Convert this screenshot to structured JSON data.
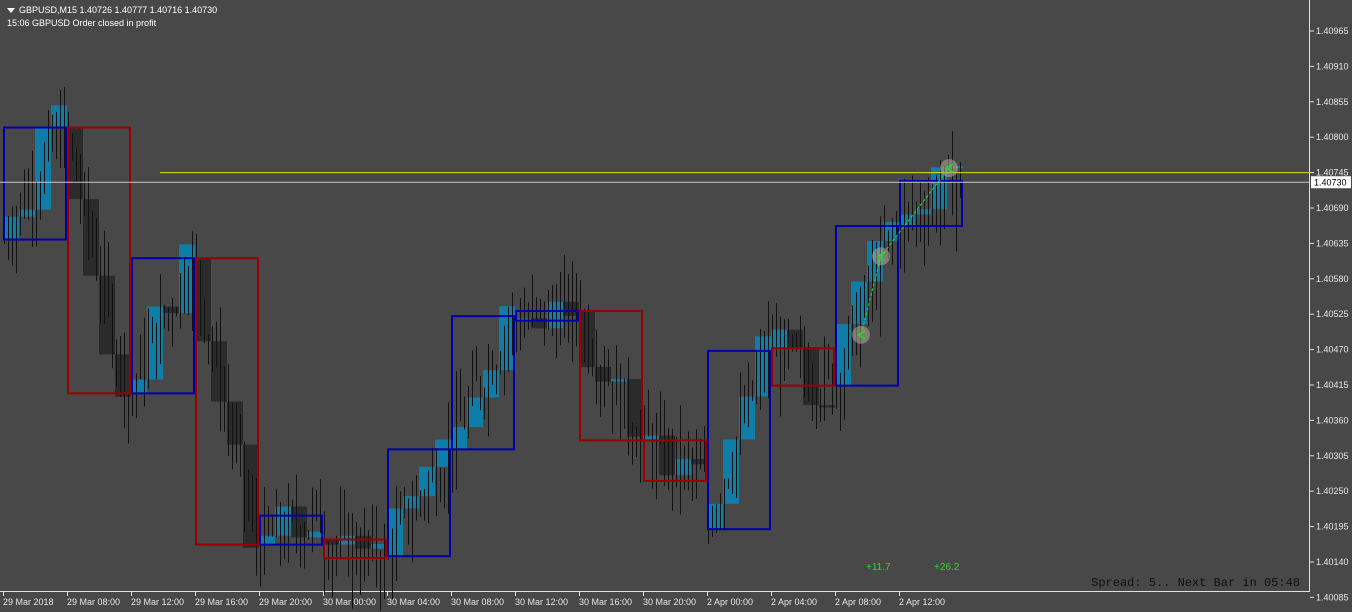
{
  "header": {
    "symbol_line": "GBPUSD,M15  1.40726 1.40777 1.40716 1.40730",
    "status_line": "15:06 GBPUSD Order closed in profit"
  },
  "price_axis": {
    "ticks": [
      "1.40965",
      "1.40910",
      "1.40855",
      "1.40800",
      "1.40745",
      "1.40690",
      "1.40635",
      "1.40580",
      "1.40525",
      "1.40470",
      "1.40415",
      "1.40360",
      "1.40305",
      "1.40250",
      "1.40195",
      "1.40140",
      "1.40085"
    ],
    "current_price": "1.40730"
  },
  "time_axis": {
    "labels": [
      "29 Mar 2018",
      "29 Mar 08:00",
      "29 Mar 12:00",
      "29 Mar 16:00",
      "29 Mar 20:00",
      "30 Mar 00:00",
      "30 Mar 04:00",
      "30 Mar 08:00",
      "30 Mar 12:00",
      "30 Mar 16:00",
      "30 Mar 20:00",
      "2 Apr 00:00",
      "2 Apr 04:00",
      "2 Apr 08:00",
      "2 Apr 12:00"
    ]
  },
  "overlay": {
    "spread_text": "Spread: 5.. Next Bar in 05:48",
    "profits": [
      "+11.7",
      "+26.2"
    ]
  },
  "colors": {
    "background": "#484848",
    "bull_body": "#0e7fae",
    "bear_body": "#2a2a2a",
    "wick": "#111111",
    "bull_box": "#0000aa",
    "bear_box": "#990000",
    "level_line": "#e0e000",
    "price_line": "#c8c8c8",
    "trade_line": "#22dd22"
  },
  "chart_data": {
    "type": "candlestick",
    "symbol": "GBPUSD",
    "timeframe": "M15",
    "last_bar": {
      "open": 1.40726,
      "high": 1.40777,
      "low": 1.40716,
      "close": 1.4073
    },
    "ylim": [
      1.4007,
      1.4103
    ],
    "horizontal_levels": [
      1.40745,
      1.4073
    ],
    "htf_boxes": [
      {
        "dir": "bull",
        "open": 1.40641,
        "close": 1.40815
      },
      {
        "dir": "bear",
        "open": 1.40815,
        "close": 1.40402
      },
      {
        "dir": "bull",
        "open": 1.40402,
        "close": 1.40612
      },
      {
        "dir": "bear",
        "open": 1.40612,
        "close": 1.40167
      },
      {
        "dir": "bull",
        "open": 1.40167,
        "close": 1.40212
      },
      {
        "dir": "bear",
        "open": 1.40175,
        "close": 1.40146
      },
      {
        "dir": "bull",
        "open": 1.40149,
        "close": 1.40315
      },
      {
        "dir": "bull",
        "open": 1.40315,
        "close": 1.40522
      },
      {
        "dir": "bull",
        "open": 1.40515,
        "close": 1.4053
      },
      {
        "dir": "bear",
        "open": 1.4053,
        "close": 1.40329
      },
      {
        "dir": "bear",
        "open": 1.40329,
        "close": 1.40266
      },
      {
        "dir": "bull",
        "open": 1.40191,
        "close": 1.40468
      },
      {
        "dir": "bear",
        "open": 1.40472,
        "close": 1.40414
      },
      {
        "dir": "bull",
        "open": 1.40414,
        "close": 1.40662
      },
      {
        "dir": "bull",
        "open": 1.40662,
        "close": 1.40732
      }
    ],
    "trade_markers": [
      {
        "price": 1.40493
      },
      {
        "price": 1.40615
      },
      {
        "price": 1.40752
      }
    ]
  }
}
